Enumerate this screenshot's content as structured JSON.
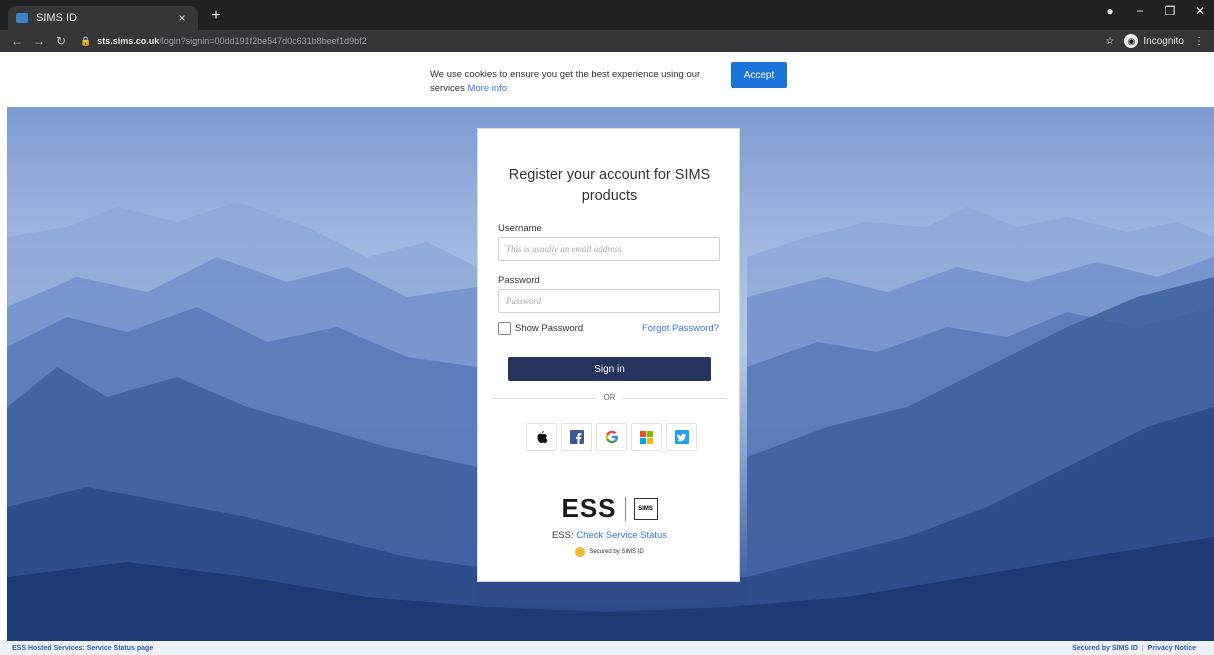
{
  "browser": {
    "tab_title": "SIMS ID",
    "tab_close": "×",
    "new_tab": "+",
    "url_host": "sts.sims.co.uk",
    "url_path": "/login?signin=00dd191f2be547d0c631b8beef1d9bf2",
    "incognito_label": "Incognito"
  },
  "cookie_banner": {
    "text": "We use cookies to ensure you get the best experience using our services",
    "link": "More info",
    "accept": "Accept"
  },
  "login": {
    "title": "Register your account for SIMS products",
    "username_label": "Username",
    "username_placeholder": "This is usually an email address",
    "password_label": "Password",
    "password_placeholder": "Password",
    "show_password": "Show Password",
    "forgot_password": "Forgot Password?",
    "sign_in": "Sign in",
    "or": "OR",
    "social": [
      {
        "name": "apple-icon"
      },
      {
        "name": "facebook-icon"
      },
      {
        "name": "google-icon"
      },
      {
        "name": "microsoft-icon"
      },
      {
        "name": "twitter-icon"
      }
    ],
    "brand_ess": "ESS",
    "brand_sims": "SIMS",
    "status_prefix": "ESS:",
    "status_link": "Check Service Status",
    "secured": "Secured by SIMS ID"
  },
  "footer": {
    "left": "ESS Hosted Services: Service Status page",
    "secured": "Secured by SIMS ID",
    "separator": "|",
    "privacy": "Privacy Notice"
  }
}
